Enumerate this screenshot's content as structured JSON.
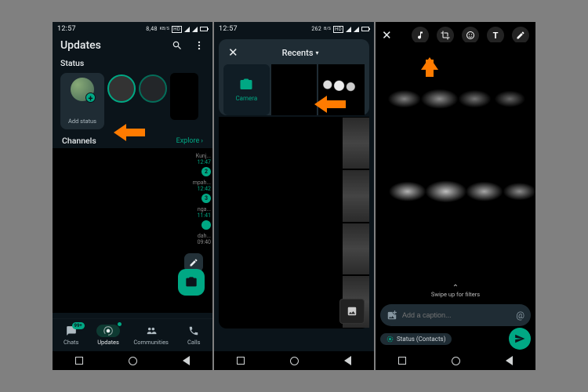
{
  "screen1": {
    "time": "12:57",
    "net_label": "8,48",
    "kbs": "KB/S",
    "title": "Updates",
    "status_heading": "Status",
    "add_status_label": "Add status",
    "channels_heading": "Channels",
    "explore_label": "Explore",
    "channel_items": [
      {
        "trail": "Kunj...",
        "time": "12:47",
        "badge": "2"
      },
      {
        "trail": "mpah...",
        "time": "12:42",
        "badge": "3"
      },
      {
        "trail": "nga...",
        "time": "11:41",
        "badge": ""
      },
      {
        "trail": "dah...",
        "time": "09:40",
        "badge": ""
      }
    ],
    "tabs": [
      {
        "label": "Chats",
        "badge": "99+"
      },
      {
        "label": "Updates",
        "badge": ""
      },
      {
        "label": "Communities",
        "badge": ""
      },
      {
        "label": "Calls",
        "badge": ""
      }
    ]
  },
  "screen2": {
    "time": "12:57",
    "net_label": "262",
    "kbs": "B/S",
    "recents_label": "Recents",
    "camera_label": "Camera"
  },
  "screen3": {
    "swipe_label": "Swipe up for filters",
    "caption_placeholder": "Add a caption...",
    "audience_label": "Status (Contacts)"
  }
}
